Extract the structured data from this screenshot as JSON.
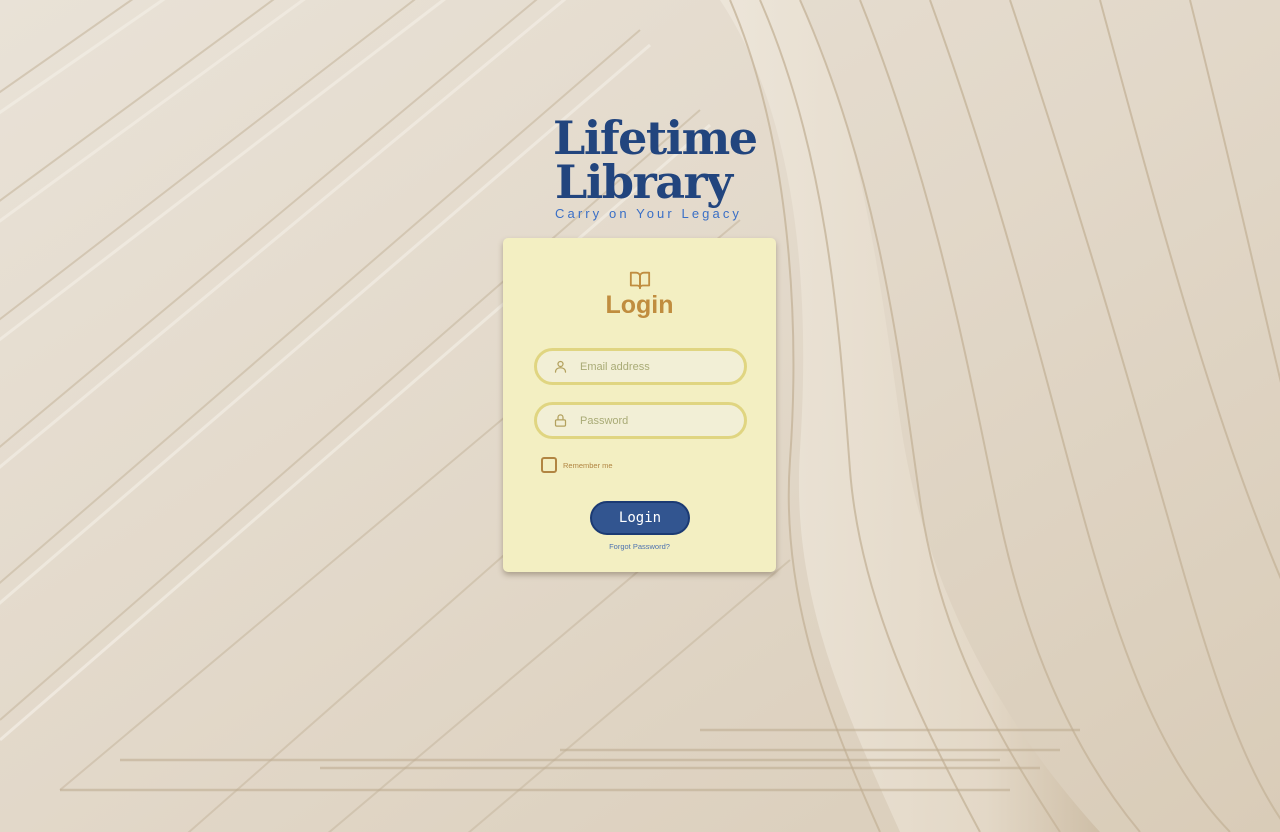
{
  "brand": {
    "title_line1": "Lifetime",
    "title_line2": "Library",
    "tagline": "Carry on Your Legacy",
    "color": "#22457e",
    "tagline_color": "#3a6fc6"
  },
  "login_card": {
    "header_icon": "open-book-icon",
    "title": "Login",
    "title_color": "#c08d3f",
    "background": "#f3efc2",
    "email": {
      "icon": "user-icon",
      "placeholder": "Email address",
      "value": ""
    },
    "password": {
      "icon": "lock-icon",
      "placeholder": "Password",
      "value": ""
    },
    "remember_me": {
      "label": "Remember me",
      "checked": false
    },
    "submit_label": "Login",
    "submit_color": "#325590",
    "forgot_password_label": "Forgot Password?"
  }
}
